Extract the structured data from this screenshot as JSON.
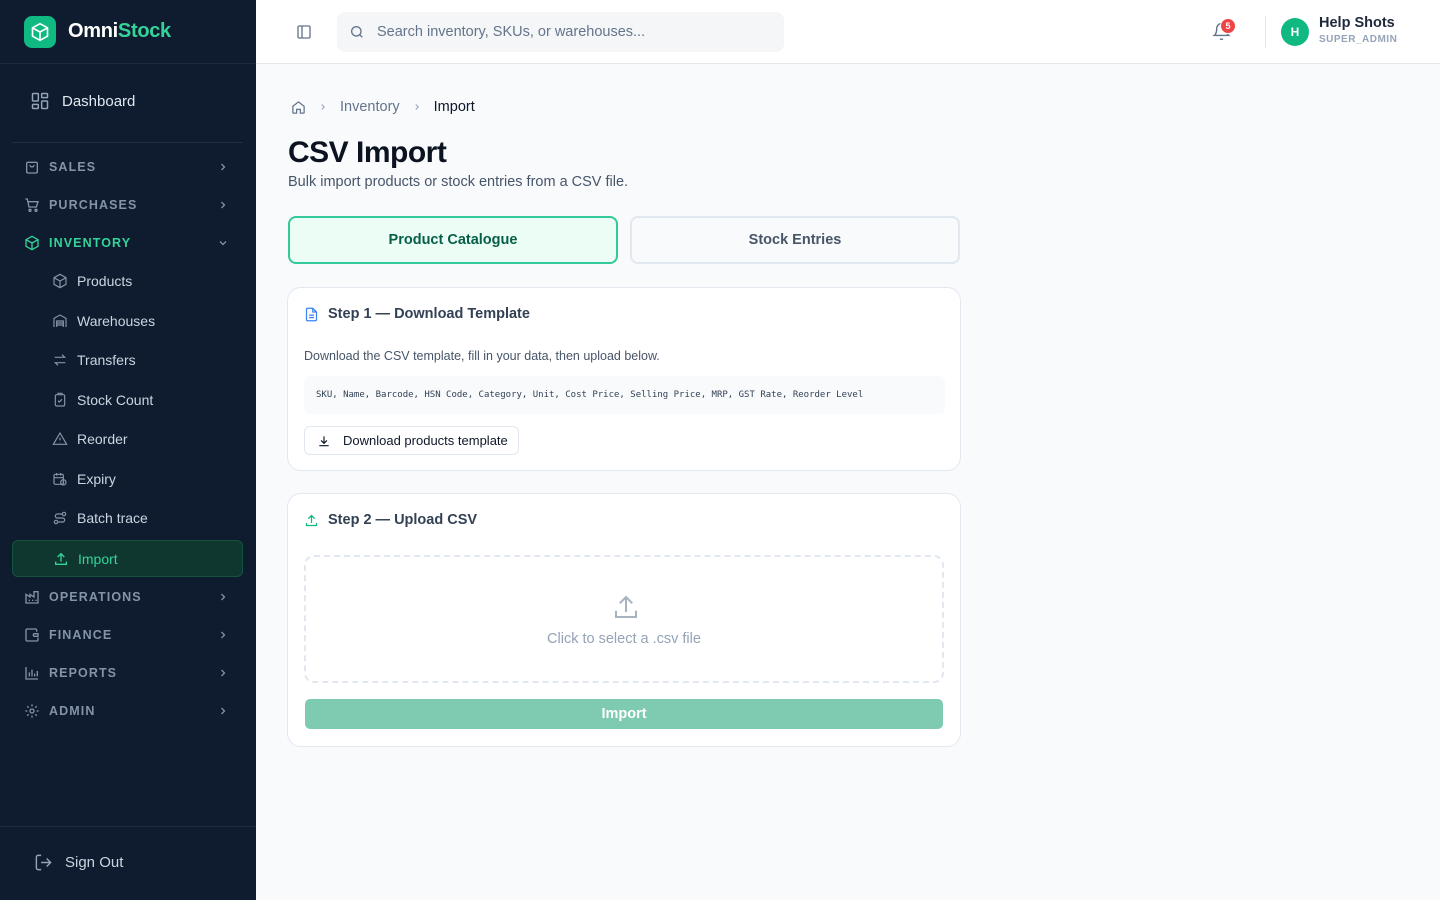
{
  "brand": {
    "name_part1": "Omni",
    "name_part2": "Stock",
    "accent_color": "#34d399"
  },
  "sidebar": {
    "dashboard_label": "Dashboard",
    "sections": {
      "sales": "SALES",
      "purchases": "PURCHASES",
      "inventory": "INVENTORY",
      "operations": "OPERATIONS",
      "finance": "FINANCE",
      "reports": "REPORTS",
      "admin": "ADMIN"
    },
    "inventory_items": {
      "products": "Products",
      "warehouses": "Warehouses",
      "transfers": "Transfers",
      "stock_count": "Stock Count",
      "reorder": "Reorder",
      "expiry": "Expiry",
      "batch_trace": "Batch trace",
      "import": "Import"
    },
    "sign_out": "Sign Out"
  },
  "header": {
    "search_placeholder": "Search inventory, SKUs, or warehouses...",
    "notification_count": "5",
    "user": {
      "initial": "H",
      "name": "Help Shots",
      "role": "SUPER_ADMIN"
    }
  },
  "breadcrumb": {
    "parent": "Inventory",
    "current": "Import"
  },
  "page": {
    "title": "CSV Import",
    "subtitle": "Bulk import products or stock entries from a CSV file."
  },
  "tabs": {
    "product_catalogue": "Product Catalogue",
    "stock_entries": "Stock Entries"
  },
  "step1": {
    "title": "Step 1 — Download Template",
    "description": "Download the CSV template, fill in your data, then upload below.",
    "columns": "SKU, Name, Barcode, HSN Code, Category, Unit, Cost Price, Selling Price, MRP, GST Rate, Reorder Level",
    "download_button": "Download products template"
  },
  "step2": {
    "title": "Step 2 — Upload CSV",
    "drop_text": "Click to select a .csv file",
    "import_button": "Import"
  }
}
